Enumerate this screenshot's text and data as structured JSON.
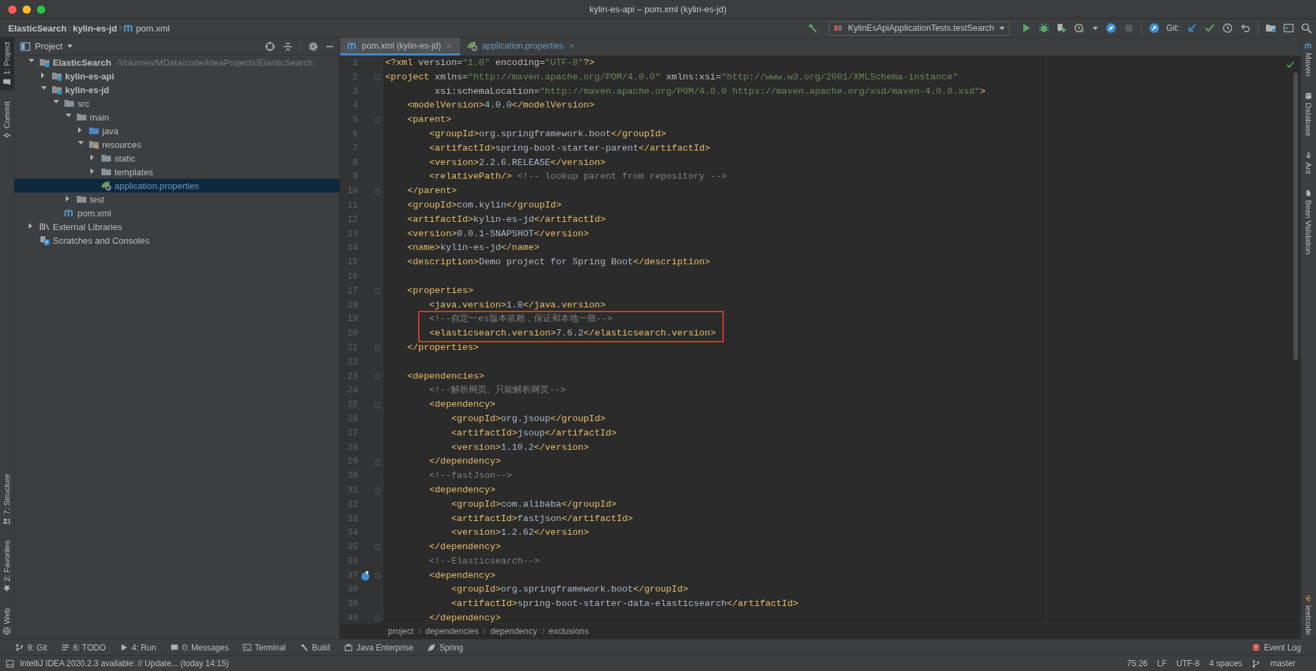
{
  "window": {
    "title": "kylin-es-api – pom.xml (kylin-es-jd)"
  },
  "nav_path": [
    {
      "label": "ElasticSearch",
      "kind": "project"
    },
    {
      "label": "kylin-es-jd",
      "kind": "module"
    },
    {
      "label": "pom.xml",
      "kind": "maven"
    }
  ],
  "toolbar": {
    "run_config": "KylinEsApiApplicationTests.testSearch",
    "git_label": "Git:"
  },
  "left_stripe": {
    "top": [
      {
        "label": "1: Project",
        "kind": "project",
        "selected": true
      },
      {
        "label": "Commit",
        "kind": "commit",
        "selected": false
      }
    ],
    "bottom": [
      {
        "label": "7: Structure",
        "kind": "structure",
        "selected": false
      },
      {
        "label": "2: Favorites",
        "kind": "favorites",
        "selected": false
      },
      {
        "label": "Web",
        "kind": "web",
        "selected": false
      }
    ]
  },
  "project_panel": {
    "title": "Project",
    "tree": [
      {
        "label": "ElasticSearch",
        "hint": "/Volumes/MData/code/IdeaProjects/ElasticSearch",
        "kind": "project",
        "expanded": true,
        "selected": false,
        "children": [
          {
            "label": "kylin-es-api",
            "kind": "module",
            "expanded": false,
            "selected": false
          },
          {
            "label": "kylin-es-jd",
            "kind": "module",
            "expanded": true,
            "selected": false,
            "children": [
              {
                "label": "src",
                "kind": "folder",
                "expanded": true,
                "selected": false,
                "children": [
                  {
                    "label": "main",
                    "kind": "folder",
                    "expanded": true,
                    "selected": false,
                    "children": [
                      {
                        "label": "java",
                        "kind": "source",
                        "expanded": false,
                        "selected": false
                      },
                      {
                        "label": "resources",
                        "kind": "resources",
                        "expanded": true,
                        "selected": false,
                        "children": [
                          {
                            "label": "static",
                            "kind": "folder",
                            "expanded": false,
                            "selected": false
                          },
                          {
                            "label": "templates",
                            "kind": "folder",
                            "expanded": false,
                            "selected": false
                          },
                          {
                            "label": "application.properties",
                            "kind": "properties",
                            "color": "#6897bb",
                            "selected": true
                          }
                        ]
                      }
                    ]
                  },
                  {
                    "label": "test",
                    "kind": "folder",
                    "expanded": false,
                    "selected": false
                  }
                ]
              },
              {
                "label": "pom.xml",
                "kind": "maven",
                "selected": false
              }
            ]
          }
        ]
      },
      {
        "label": "External Libraries",
        "kind": "libraries",
        "expanded": false,
        "selected": false
      },
      {
        "label": "Scratches and Consoles",
        "kind": "scratches",
        "selected": false
      }
    ]
  },
  "editor": {
    "tabs": [
      {
        "label": "pom.xml (kylin-es-jd)",
        "kind": "maven",
        "selected": true
      },
      {
        "label": "application.properties",
        "kind": "properties",
        "color": "#6897bb",
        "selected": false
      }
    ],
    "lines": [
      {
        "n": "1",
        "text": "<?xml version=\"1.0\" encoding=\"UTF-8\"?>"
      },
      {
        "n": "2",
        "fold": true,
        "text": "<project xmlns=\"http://maven.apache.org/POM/4.0.0\" xmlns:xsi=\"http://www.w3.org/2001/XMLSchema-instance\""
      },
      {
        "n": "3",
        "text": "         xsi:schemaLocation=\"http://maven.apache.org/POM/4.0.0 https://maven.apache.org/xsd/maven-4.0.0.xsd\">"
      },
      {
        "n": "4",
        "text": "    <modelVersion>4.0.0</modelVersion>"
      },
      {
        "n": "5",
        "fold": true,
        "text": "    <parent>"
      },
      {
        "n": "6",
        "text": "        <groupId>org.springframework.boot</groupId>"
      },
      {
        "n": "7",
        "text": "        <artifactId>spring-boot-starter-parent</artifactId>"
      },
      {
        "n": "8",
        "text": "        <version>2.2.6.RELEASE</version>"
      },
      {
        "n": "9",
        "text": "        <relativePath/> <!-- lookup parent from repository -->"
      },
      {
        "n": "10",
        "fold": true,
        "text": "    </parent>"
      },
      {
        "n": "11",
        "text": "    <groupId>com.kylin</groupId>"
      },
      {
        "n": "12",
        "text": "    <artifactId>kylin-es-jd</artifactId>"
      },
      {
        "n": "13",
        "text": "    <version>0.0.1-SNAPSHOT</version>"
      },
      {
        "n": "14",
        "text": "    <name>kylin-es-jd</name>"
      },
      {
        "n": "15",
        "text": "    <description>Demo project for Spring Boot</description>"
      },
      {
        "n": "16"
      },
      {
        "n": "17",
        "fold": true,
        "text": "    <properties>"
      },
      {
        "n": "18",
        "text": "        <java.version>1.8</java.version>"
      },
      {
        "n": "19",
        "boxed": true,
        "text": "        <!--自定一es版本依赖，保证和本地一致-->"
      },
      {
        "n": "20",
        "boxed": true,
        "text": "        <elasticsearch.version>7.6.2</elasticsearch.version>"
      },
      {
        "n": "21",
        "fold": true,
        "text": "    </properties>"
      },
      {
        "n": "22"
      },
      {
        "n": "23",
        "fold": true,
        "text": "    <dependencies>"
      },
      {
        "n": "24",
        "text": "        <!--解析网页。只能解析网页-->"
      },
      {
        "n": "25",
        "fold": true,
        "text": "        <dependency>"
      },
      {
        "n": "26",
        "text": "            <groupId>org.jsoup</groupId>"
      },
      {
        "n": "27",
        "text": "            <artifactId>jsoup</artifactId>"
      },
      {
        "n": "28",
        "text": "            <version>1.10.2</version>"
      },
      {
        "n": "29",
        "fold": true,
        "text": "        </dependency>"
      },
      {
        "n": "30",
        "text": "        <!--fastJson-->"
      },
      {
        "n": "31",
        "fold": true,
        "text": "        <dependency>"
      },
      {
        "n": "32",
        "text": "            <groupId>com.alibaba</groupId>"
      },
      {
        "n": "33",
        "text": "            <artifactId>fastjson</artifactId>"
      },
      {
        "n": "34",
        "text": "            <version>1.2.62</version>"
      },
      {
        "n": "35",
        "fold": true,
        "text": "        </dependency>"
      },
      {
        "n": "36",
        "text": "        <!--Elasticsearch-->"
      },
      {
        "n": "37",
        "fold": true,
        "gutter_icon": true,
        "text": "        <dependency>"
      },
      {
        "n": "38",
        "text": "            <groupId>org.springframework.boot</groupId>"
      },
      {
        "n": "39",
        "text": "            <artifactId>spring-boot-starter-data-elasticsearch</artifactId>"
      },
      {
        "n": "40",
        "fold": true,
        "text": "        </dependency>"
      }
    ],
    "breadcrumbs": [
      "project",
      "dependencies",
      "dependency",
      "exclusions"
    ]
  },
  "right_stripe": {
    "top": [
      {
        "label": "Maven",
        "kind": "maven"
      },
      {
        "label": "Database",
        "kind": "database"
      },
      {
        "label": "Ant",
        "kind": "ant"
      },
      {
        "label": "Bean Validation",
        "kind": "bean"
      }
    ],
    "bottom": [
      {
        "label": "leetcode",
        "kind": "leetcode"
      }
    ]
  },
  "tool_windows": [
    {
      "label": "9: Git",
      "kind": "git"
    },
    {
      "label": "6: TODO",
      "kind": "todo"
    },
    {
      "label": "4: Run",
      "kind": "run"
    },
    {
      "label": "0: Messages",
      "kind": "messages"
    },
    {
      "label": "Terminal",
      "kind": "terminal"
    },
    {
      "label": "Build",
      "kind": "build"
    },
    {
      "label": "Java Enterprise",
      "kind": "javaee"
    },
    {
      "label": "Spring",
      "kind": "spring"
    }
  ],
  "event_log": "Event Log",
  "status_bar": {
    "message": "IntelliJ IDEA 2020.2.3 available: // Update... (today 14:15)",
    "items": [
      "75:26",
      "LF",
      "UTF-8",
      "4 spaces",
      "master"
    ]
  }
}
